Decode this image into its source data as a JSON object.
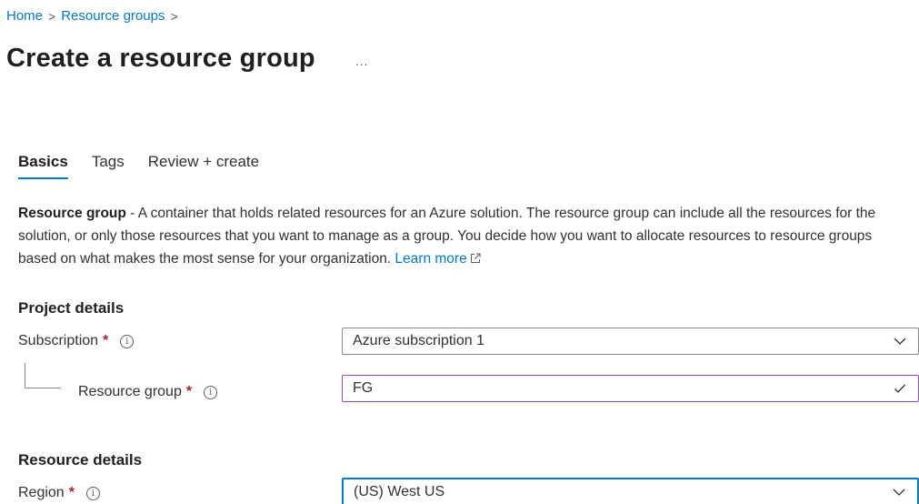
{
  "breadcrumb": {
    "home": "Home",
    "resource_groups": "Resource groups",
    "separator": ">"
  },
  "page": {
    "title": "Create a resource group",
    "more": "..."
  },
  "tabs": [
    {
      "label": "Basics",
      "active": true
    },
    {
      "label": "Tags",
      "active": false
    },
    {
      "label": "Review + create",
      "active": false
    }
  ],
  "description": {
    "term": "Resource group",
    "text": " - A container that holds related resources for an Azure solution. The resource group can include all the resources for the solution, or only those resources that you want to manage as a group. You decide how you want to allocate resources to resource groups based on what makes the most sense for your organization. ",
    "link": "Learn more"
  },
  "project_details": {
    "title": "Project details",
    "subscription": {
      "label": "Subscription",
      "required": "*",
      "value": "Azure subscription 1"
    },
    "resource_group": {
      "label": "Resource group",
      "required": "*",
      "value": "FG"
    }
  },
  "resource_details": {
    "title": "Resource details",
    "region": {
      "label": "Region",
      "required": "*",
      "value": "(US) West US"
    }
  },
  "icons": {
    "info": "info-icon",
    "chevron": "chevron-down-icon",
    "check": "checkmark-icon",
    "external": "external-link-icon"
  },
  "colors": {
    "accent": "#0078d4",
    "required": "#a4262c",
    "valid_border": "#8e4bc9"
  }
}
